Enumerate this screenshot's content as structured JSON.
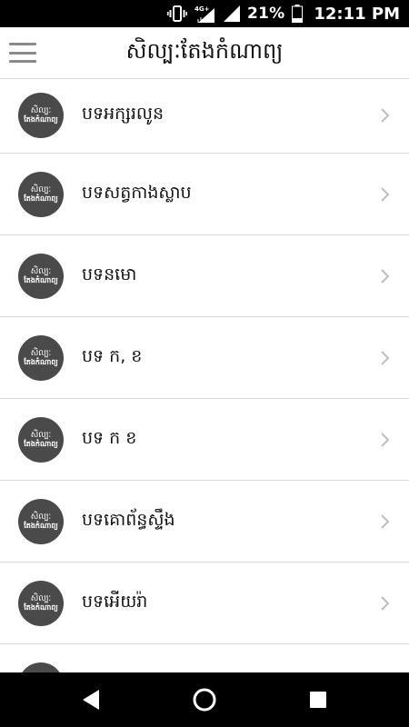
{
  "status_bar": {
    "network": "4G+",
    "battery_percent": "21%",
    "time": "12:11 PM"
  },
  "header": {
    "title": "សិល្បៈតែងកំណាព្យ"
  },
  "avatar": {
    "line1": "សិល្បៈ",
    "line2": "តែងកំណាព្យ"
  },
  "items": [
    {
      "label": "បទអក្សរលូន"
    },
    {
      "label": "បទសត្វកាងស្លាប"
    },
    {
      "label": "បទនមោ"
    },
    {
      "label": "បទ ក, ខ"
    },
    {
      "label": "បទ ក ខ"
    },
    {
      "label": "បទគោព័ន្ធស្ទឹង"
    },
    {
      "label": "បទអើយរ៉ា"
    }
  ],
  "icons": {
    "menu": "hamburger-icon",
    "chevron": "chevron-right-icon",
    "back": "back-icon",
    "home": "home-icon",
    "recent": "recent-apps-icon"
  }
}
